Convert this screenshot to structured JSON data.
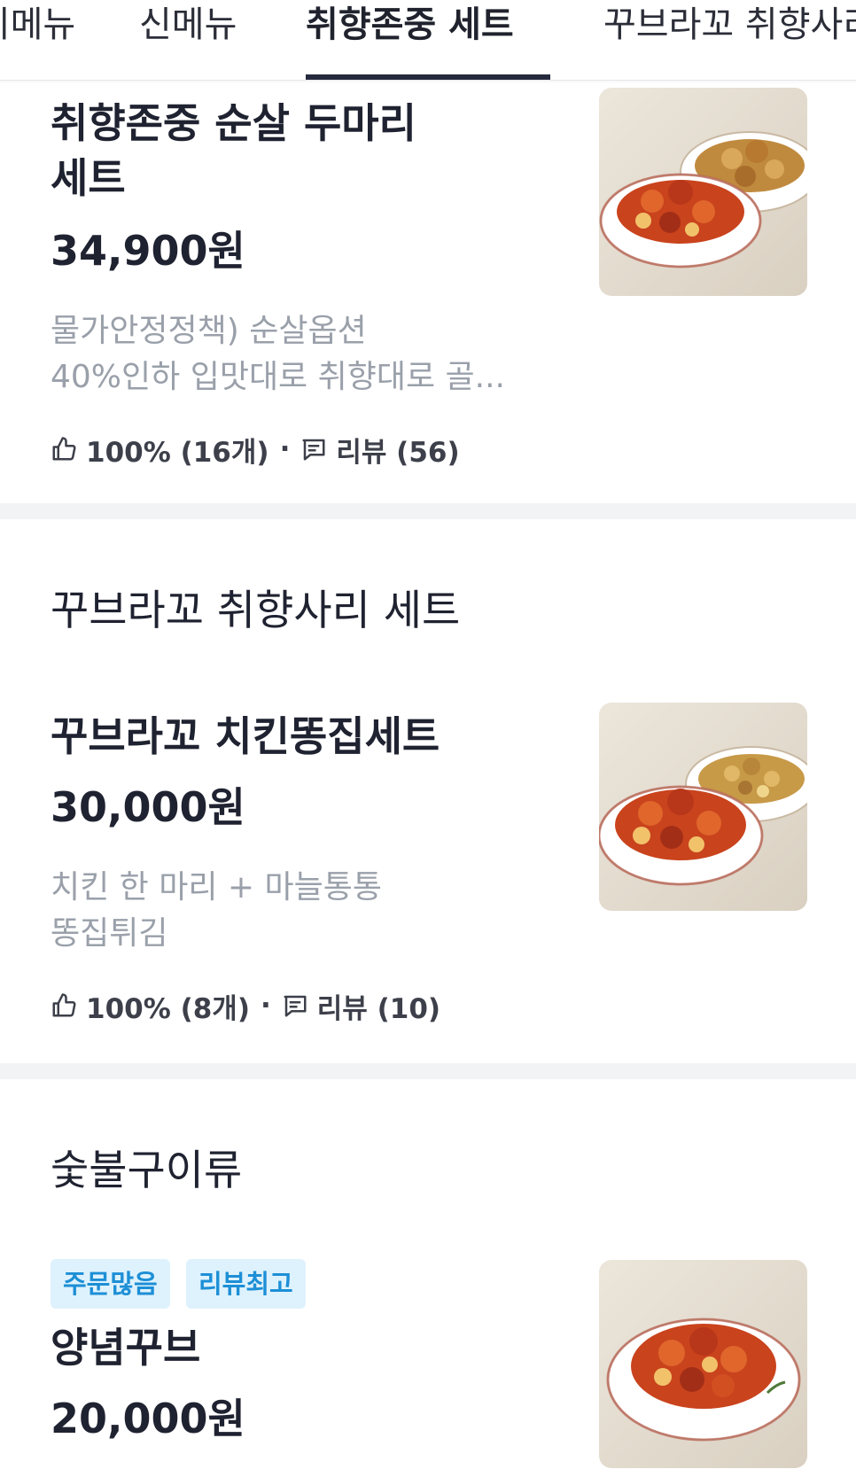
{
  "tabs": [
    {
      "label": "인기메뉴"
    },
    {
      "label": "신메뉴"
    },
    {
      "label": "취향존중 세트"
    },
    {
      "label": "꾸브라꼬 취향사리 세트"
    }
  ],
  "items": [
    {
      "title_line1": "취향존중 순살 두마리",
      "title_line2": "세트",
      "price": "34,900원",
      "desc_line1": "물가안정정책) 순살옵션",
      "desc_line2": "40%인하 입맛대로 취향대로 골...",
      "rating": "100% (16개)",
      "reviews": "리뷰 (56)"
    },
    {
      "title": "꾸브라꼬 치킨똥집세트",
      "price": "30,000원",
      "desc_line1": "치킨 한 마리 + 마늘통통",
      "desc_line2": "똥집튀김",
      "rating": "100% (8개)",
      "reviews": "리뷰 (10)"
    },
    {
      "badges": [
        "주문많음",
        "리뷰최고"
      ],
      "title": "양념꾸브",
      "price": "20,000원"
    }
  ],
  "categories": [
    {
      "title": "꾸브라꼬 취향사리 세트"
    },
    {
      "title": "숯불구이류"
    }
  ],
  "separator": "·",
  "colors": {
    "active_tab_underline": "#262a3d",
    "badge_bg": "#def2fd",
    "badge_text": "#1d8fd6",
    "description": "#9aa0aa"
  }
}
